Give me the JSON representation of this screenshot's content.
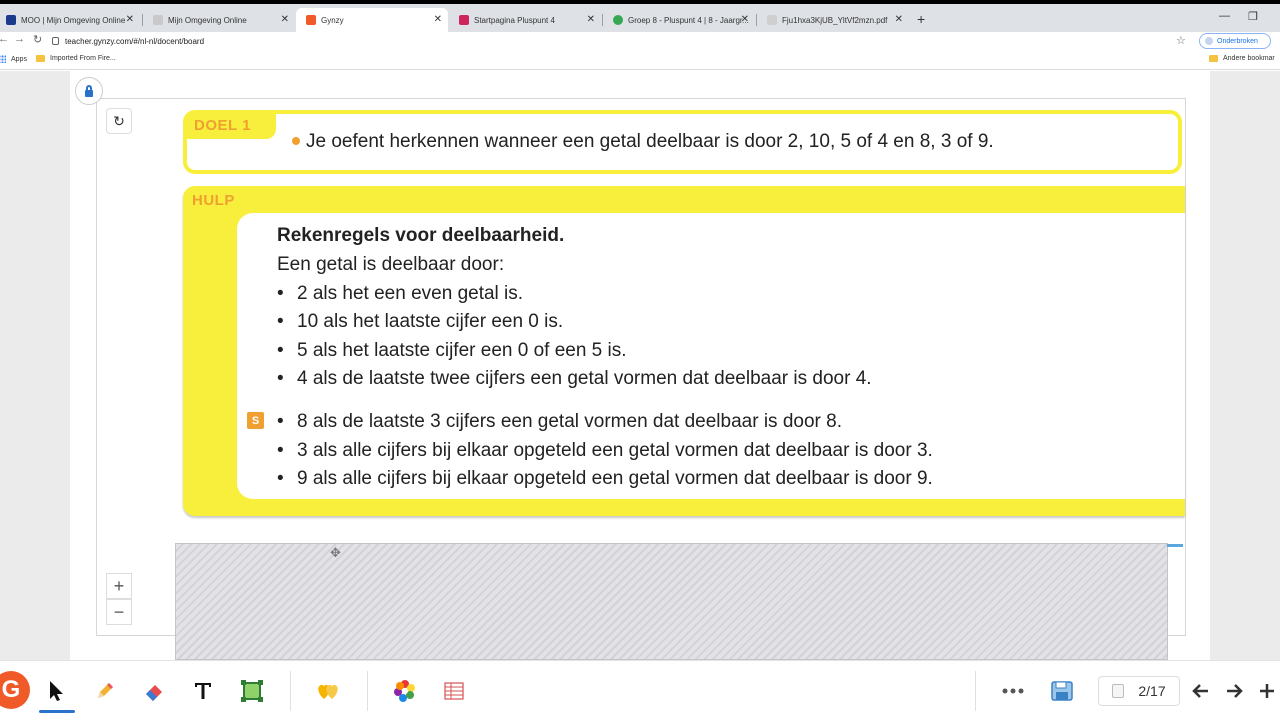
{
  "browser": {
    "tabs": [
      {
        "title": "MOO | Mijn Omgeving Online",
        "fav_color": "#1a3a8c"
      },
      {
        "title": "Mijn Omgeving Online",
        "fav_color": "#c9c9c9"
      },
      {
        "title": "Gynzy",
        "fav_color": "#f05a28"
      },
      {
        "title": "Startpagina Pluspunt 4",
        "fav_color": "#d0245c"
      },
      {
        "title": "Groep 8 - Pluspunt 4 | 8 - Jaargr...",
        "fav_color": "#34a853"
      },
      {
        "title": "Fju1hxa3KjUB_YltVf2mzn.pdf",
        "fav_color": "#cfcfcf"
      }
    ],
    "active_tab": 2,
    "url": "teacher.gynzy.com/#/nl-nl/docent/board",
    "profile_label": "Onderbroken",
    "bookmarks": {
      "apps": "Apps",
      "imported": "Imported From Fire...",
      "other": "Andere bookmar"
    }
  },
  "lesson": {
    "doel_label": "DOEL 1",
    "doel_text": "Je oefent herkennen wanneer een getal deelbaar is door 2, 10, 5 of 4 en 8, 3 of 9.",
    "hulp_label": "HULP",
    "hulp_title": "Rekenregels voor deelbaarheid.",
    "hulp_intro": "Een getal is deelbaar door:",
    "rules": [
      "2 als het een even getal is.",
      "10 als het laatste cijfer een 0 is.",
      "5 als het laatste cijfer een 0 of een 5 is.",
      "4 als de laatste twee cijfers een getal vormen dat deelbaar is door 4.",
      "8 als de laatste 3 cijfers een getal vormen dat deelbaar is door 8.",
      "3 als alle cijfers bij elkaar opgeteld een getal vormen dat deelbaar is door 3.",
      "9 als alle cijfers bij elkaar opgeteld een getal vormen dat deelbaar is door 9."
    ],
    "s_badge": "S",
    "bullet": "•"
  },
  "board": {
    "zoom_in": "+",
    "zoom_out": "−"
  },
  "toolbar": {
    "logo": "G",
    "page_counter": "2/17",
    "tools": [
      "pointer-icon",
      "pencil-icon",
      "eraser-icon",
      "text-icon",
      "shape-icon",
      "hearts-icon",
      "color-wheel-icon",
      "table-icon",
      "more-icon",
      "save-icon",
      "prev-page-icon",
      "next-page-icon",
      "add-page-icon"
    ],
    "accent": "#2a72c9",
    "brand": "#f05a28"
  }
}
